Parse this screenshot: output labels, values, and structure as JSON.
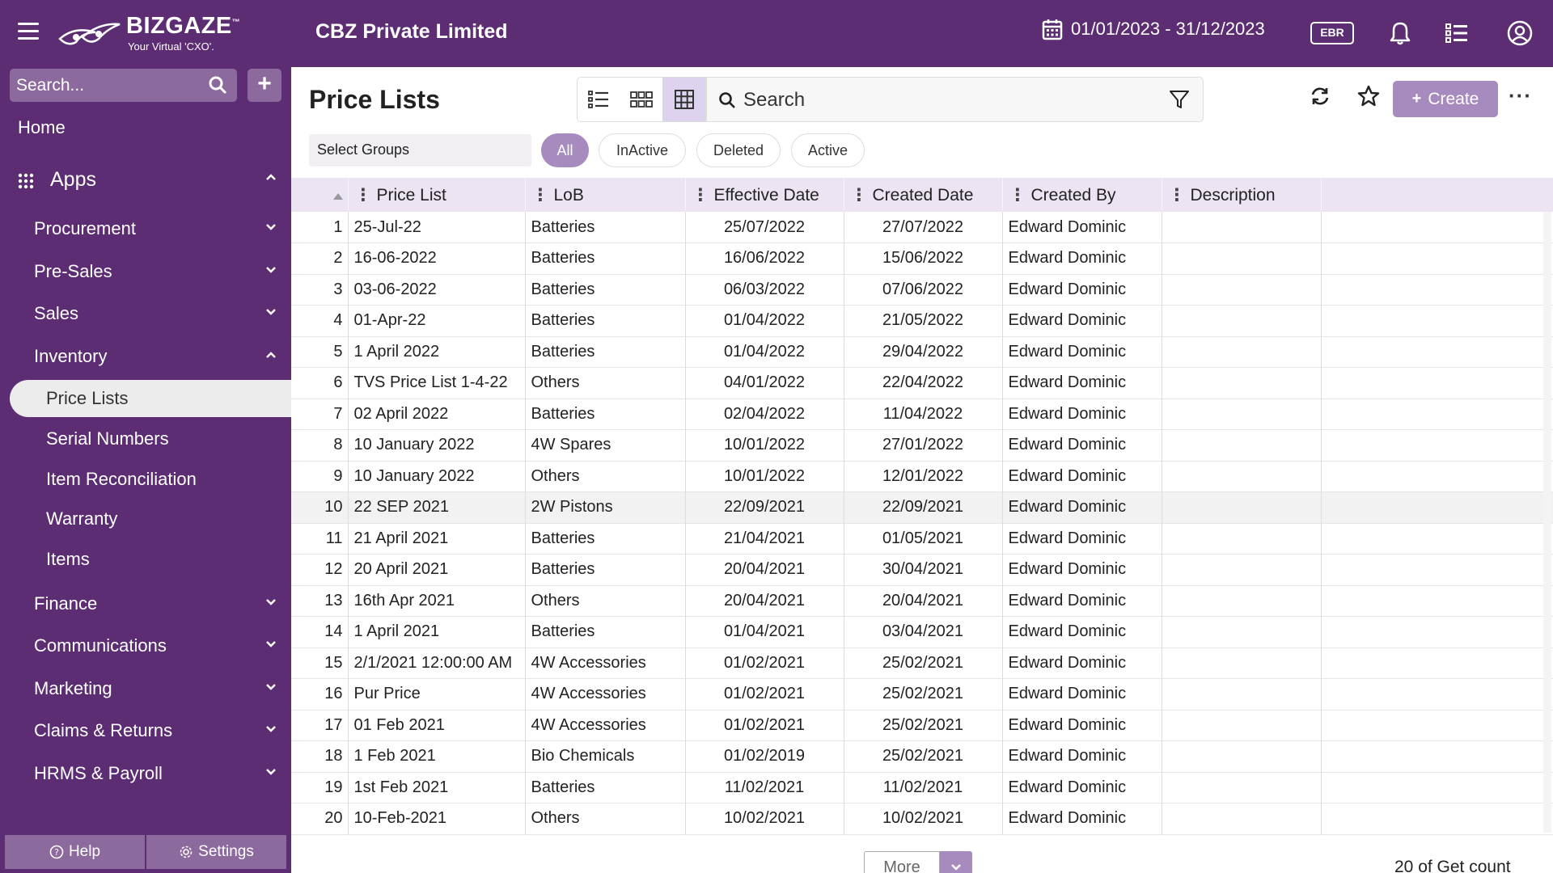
{
  "header": {
    "logo_title": "BIZGAZE",
    "logo_tm": "™",
    "logo_sub": "Your Virtual 'CXO'.",
    "company": "CBZ Private Limited",
    "date_range": "01/01/2023 - 31/12/2023",
    "ebr": "EBR"
  },
  "sidebar": {
    "search_placeholder": "Search...",
    "add_label": "+",
    "home": "Home",
    "apps": "Apps",
    "items": [
      {
        "label": "Procurement"
      },
      {
        "label": "Pre-Sales"
      },
      {
        "label": "Sales"
      },
      {
        "label": "Inventory"
      },
      {
        "label": "Finance"
      },
      {
        "label": "Communications"
      },
      {
        "label": "Marketing"
      },
      {
        "label": "Claims & Returns"
      },
      {
        "label": "HRMS & Payroll"
      }
    ],
    "sub_items": [
      {
        "label": "Price Lists"
      },
      {
        "label": "Serial Numbers"
      },
      {
        "label": "Item Reconciliation"
      },
      {
        "label": "Warranty"
      },
      {
        "label": "Items"
      }
    ],
    "help": "Help",
    "settings": "Settings"
  },
  "main": {
    "title": "Price Lists",
    "search_placeholder": "Search",
    "create_label": "Create",
    "more_label": "···",
    "group_select": "Select Groups",
    "filters": [
      "All",
      "InActive",
      "Deleted",
      "Active"
    ],
    "columns": [
      "Price List",
      "LoB",
      "Effective Date",
      "Created Date",
      "Created By",
      "Description"
    ],
    "rows": [
      [
        "1",
        "25-Jul-22",
        "Batteries",
        "25/07/2022",
        "27/07/2022",
        "Edward Dominic",
        ""
      ],
      [
        "2",
        "16-06-2022",
        "Batteries",
        "16/06/2022",
        "15/06/2022",
        "Edward Dominic",
        ""
      ],
      [
        "3",
        "03-06-2022",
        "Batteries",
        "06/03/2022",
        "07/06/2022",
        "Edward Dominic",
        ""
      ],
      [
        "4",
        "01-Apr-22",
        "Batteries",
        "01/04/2022",
        "21/05/2022",
        "Edward Dominic",
        ""
      ],
      [
        "5",
        "1 April 2022",
        "Batteries",
        "01/04/2022",
        "29/04/2022",
        "Edward Dominic",
        ""
      ],
      [
        "6",
        "TVS Price List 1-4-22",
        "Others",
        "04/01/2022",
        "22/04/2022",
        "Edward Dominic",
        ""
      ],
      [
        "7",
        "02 April 2022",
        "Batteries",
        "02/04/2022",
        "11/04/2022",
        "Edward Dominic",
        ""
      ],
      [
        "8",
        "10 January 2022",
        "4W Spares",
        "10/01/2022",
        "27/01/2022",
        "Edward Dominic",
        ""
      ],
      [
        "9",
        "10 January 2022",
        "Others",
        "10/01/2022",
        "12/01/2022",
        "Edward Dominic",
        ""
      ],
      [
        "10",
        "22 SEP 2021",
        "2W Pistons",
        "22/09/2021",
        "22/09/2021",
        "Edward Dominic",
        ""
      ],
      [
        "11",
        "21 April 2021",
        "Batteries",
        "21/04/2021",
        "01/05/2021",
        "Edward Dominic",
        ""
      ],
      [
        "12",
        "20 April 2021",
        "Batteries",
        "20/04/2021",
        "30/04/2021",
        "Edward Dominic",
        ""
      ],
      [
        "13",
        "16th Apr 2021",
        "Others",
        "20/04/2021",
        "20/04/2021",
        "Edward Dominic",
        ""
      ],
      [
        "14",
        "1 April 2021",
        "Batteries",
        "01/04/2021",
        "03/04/2021",
        "Edward Dominic",
        ""
      ],
      [
        "15",
        "2/1/2021 12:00:00 AM",
        "4W Accessories",
        "01/02/2021",
        "25/02/2021",
        "Edward Dominic",
        ""
      ],
      [
        "16",
        "Pur Price",
        "4W Accessories",
        "01/02/2021",
        "25/02/2021",
        "Edward Dominic",
        ""
      ],
      [
        "17",
        "01 Feb 2021",
        "4W Accessories",
        "01/02/2021",
        "25/02/2021",
        "Edward Dominic",
        ""
      ],
      [
        "18",
        "1 Feb 2021",
        "Bio Chemicals",
        "01/02/2019",
        "25/02/2021",
        "Edward Dominic",
        ""
      ],
      [
        "19",
        "1st Feb 2021",
        "Batteries",
        "11/02/2021",
        "11/02/2021",
        "Edward Dominic",
        ""
      ],
      [
        "20",
        "10-Feb-2021",
        "Others",
        "10/02/2021",
        "10/02/2021",
        "Edward Dominic",
        ""
      ]
    ],
    "highlighted_row": 10,
    "more_button": "More",
    "count_text": "20 of Get count"
  },
  "colors": {
    "brand": "#5c2d73",
    "accent": "#a78bbf",
    "header_row": "#ece4f2"
  },
  "icons": [
    "hamburger-icon",
    "calendar-icon",
    "bell-icon",
    "list-icon",
    "user-icon",
    "search-icon",
    "filter-icon",
    "refresh-icon",
    "star-icon",
    "grid-icon",
    "chevron-down-icon",
    "chevron-up-icon",
    "help-icon",
    "gear-icon"
  ]
}
